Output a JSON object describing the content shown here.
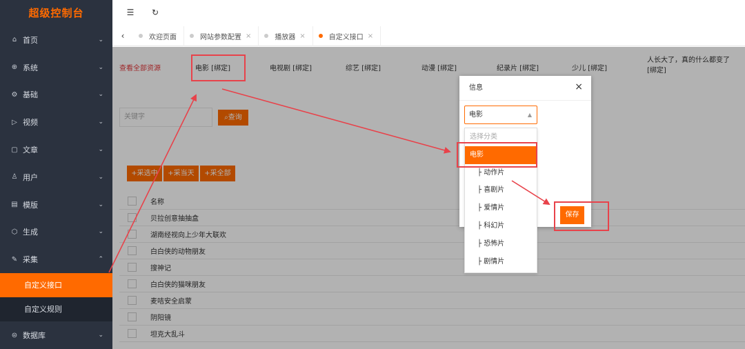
{
  "app_title": "超级控制台",
  "sidebar": {
    "items": [
      {
        "label": "首页",
        "icon": "⌂"
      },
      {
        "label": "系统",
        "icon": "⊕"
      },
      {
        "label": "基础",
        "icon": "⚙"
      },
      {
        "label": "视频",
        "icon": "▷"
      },
      {
        "label": "文章",
        "icon": "▢"
      },
      {
        "label": "用户",
        "icon": "♙"
      },
      {
        "label": "模版",
        "icon": "▤"
      },
      {
        "label": "生成",
        "icon": "⬡"
      },
      {
        "label": "采集",
        "icon": "✎"
      }
    ],
    "sub_items": [
      "自定义接口",
      "自定义规则"
    ],
    "bottom_item": {
      "label": "数据库",
      "icon": "⊜"
    },
    "chevron_down": "⌄",
    "chevron_up": "⌃"
  },
  "topbar": {
    "menu_icon": "☰",
    "refresh_icon": "↻"
  },
  "tabs": {
    "back_icon": "‹",
    "close_icon": "×",
    "items": [
      "欢迎页面",
      "网站参数配置",
      "播放器",
      "自定义接口"
    ]
  },
  "categories": [
    "查看全部资源",
    "电影 [绑定]",
    "电视剧 [绑定]",
    "综艺 [绑定]",
    "动漫 [绑定]",
    "纪录片 [绑定]",
    "少儿 [绑定]",
    "人长大了，真的什么都变了 [绑定]"
  ],
  "search": {
    "placeholder": "关键字",
    "button": "查询"
  },
  "actions": [
    "+采选中",
    "+采当天",
    "+采全部"
  ],
  "table": {
    "header": "名称",
    "rows": [
      "贝拉创意抽抽盒",
      "湖南经视向上少年大联欢",
      "白白侠的动物朋友",
      "搜神记",
      "白白侠的猫咪朋友",
      "麦咭安全启蒙",
      "阴阳镜",
      "坦克大乱斗"
    ]
  },
  "dialog": {
    "title": "信息",
    "close_icon": "×",
    "selected_value": "电影",
    "caret_icon": "▲",
    "save_label": "保存"
  },
  "dropdown": {
    "placeholder": "选择分类",
    "selected": "电影",
    "children": [
      "├ 动作片",
      "├ 喜剧片",
      "├ 爱情片",
      "├ 科幻片",
      "├ 恐怖片",
      "├ 剧情片"
    ]
  },
  "colors": {
    "accent": "#ff6a00",
    "sidebar_bg": "#2b323f",
    "annotation": "#e8424a",
    "link_red": "#e4393c"
  }
}
